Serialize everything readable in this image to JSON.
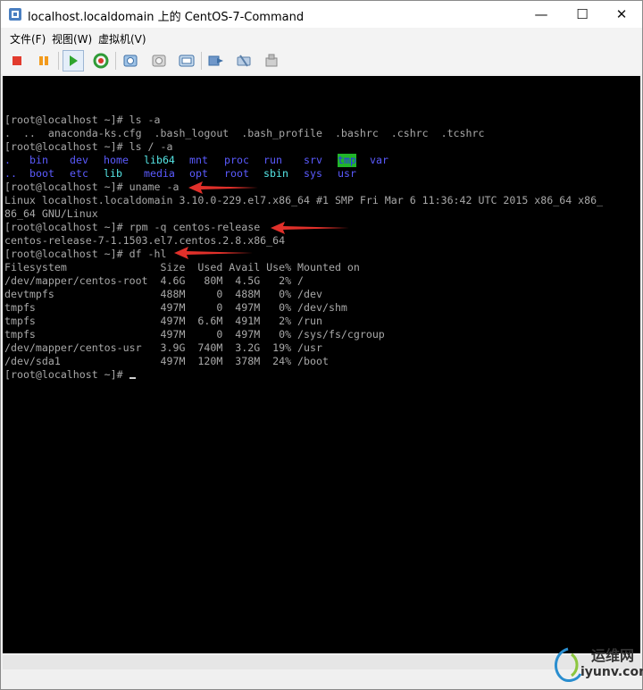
{
  "window": {
    "title": "localhost.localdomain 上的 CentOS-7-Command",
    "minimize_glyph": "—",
    "maximize_glyph": "☐",
    "close_glyph": "✕"
  },
  "menu": {
    "items": [
      "文件(F)",
      "视图(W)",
      "虚拟机(V)"
    ]
  },
  "toolbar": {
    "buttons": [
      {
        "name": "stop-icon",
        "color": "#e23b2e"
      },
      {
        "name": "pause-icon",
        "color": "#f29a1c"
      },
      {
        "name": "play-icon",
        "color": "#2fa52f",
        "active": true
      },
      {
        "name": "reset-icon",
        "color": "#2f9b37"
      },
      {
        "name": "snapshot-icon"
      },
      {
        "name": "revert-snapshot-icon"
      },
      {
        "name": "manage-snapshots-icon"
      },
      {
        "name": "send-ctrl-alt-del-icon"
      },
      {
        "name": "settings-icon"
      },
      {
        "name": "plugin-icon"
      }
    ]
  },
  "terminal": {
    "prompt": "[root@localhost ~]#",
    "cmd_ls": " ls -a",
    "ls_out": ".  ..  anaconda-ks.cfg  .bash_logout  .bash_profile  .bashrc  .cshrc  .tcshrc",
    "cmd_ls_root": " ls / -a",
    "root_dirs_row1": [
      ".",
      "bin",
      "dev",
      "home",
      "lib64",
      "mnt",
      "proc",
      "run",
      "srv",
      "tmp",
      "var"
    ],
    "root_dirs_row2": [
      "..",
      "boot",
      "etc",
      "lib",
      "media",
      "opt",
      "root",
      "sbin",
      "sys",
      "usr"
    ],
    "cmd_uname": " uname -a",
    "uname_out_1": "Linux localhost.localdomain 3.10.0-229.el7.x86_64 #1 SMP Fri Mar 6 11:36:42 UTC 2015 x86_64 x86_",
    "uname_out_2": "86_64 GNU/Linux",
    "cmd_rpm": " rpm -q centos-release",
    "rpm_out": "centos-release-7-1.1503.el7.centos.2.8.x86_64",
    "cmd_df": " df -hl",
    "df_header": "Filesystem               Size  Used Avail Use% Mounted on",
    "df_rows": [
      "/dev/mapper/centos-root  4.6G   80M  4.5G   2% /",
      "devtmpfs                 488M     0  488M   0% /dev",
      "tmpfs                    497M     0  497M   0% /dev/shm",
      "tmpfs                    497M  6.6M  491M   2% /run",
      "tmpfs                    497M     0  497M   0% /sys/fs/cgroup",
      "/dev/mapper/centos-usr   3.9G  740M  3.2G  19% /usr",
      "/dev/sda1                497M  120M  378M  24% /boot"
    ],
    "final_prompt": "[root@localhost ~]# "
  },
  "watermark": {
    "cn": "运维网",
    "en": "iyunv.com"
  }
}
